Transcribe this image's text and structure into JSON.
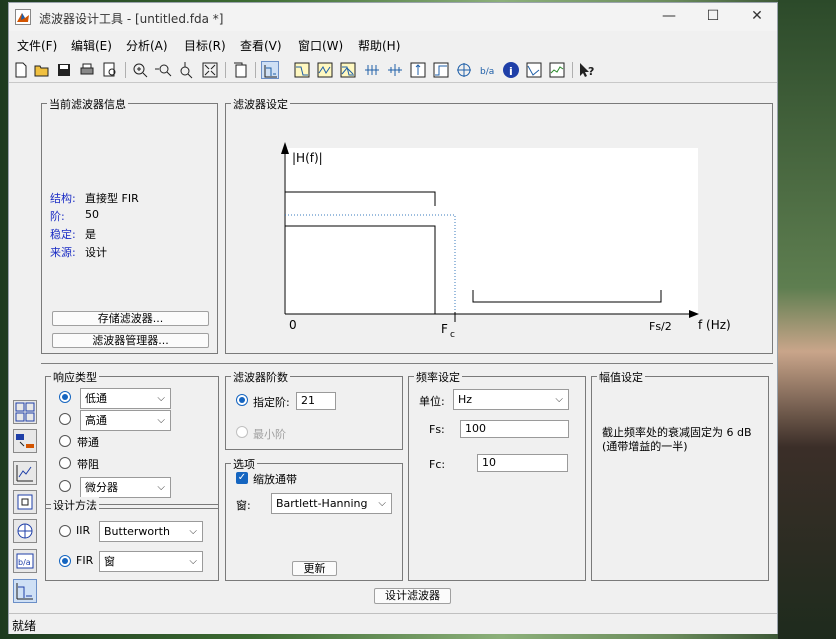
{
  "window": {
    "title": "滤波器设计工具 - [untitled.fda *]",
    "minimize": "—",
    "maximize": "☐",
    "close": "✕"
  },
  "menu": [
    "文件(F)",
    "编辑(E)",
    "分析(A)",
    "目标(R)",
    "查看(V)",
    "窗口(W)",
    "帮助(H)"
  ],
  "info": {
    "title": "当前滤波器信息",
    "rows": [
      {
        "label": "结构:",
        "value": "直接型 FIR"
      },
      {
        "label": "阶:",
        "value": "50"
      },
      {
        "label": "稳定:",
        "value": "是"
      },
      {
        "label": "来源:",
        "value": "设计"
      }
    ],
    "store_button": "存储滤波器...",
    "manager_button": "滤波器管理器..."
  },
  "spec": {
    "title": "滤波器设定",
    "ylabel": "|H(f)|",
    "x0": "0",
    "fc_main": "F",
    "fc_sub": "c",
    "fs2": "Fs/2",
    "xlabel": "f (Hz)"
  },
  "response": {
    "title": "响应类型",
    "options": [
      {
        "label": "低通",
        "selected": true
      },
      {
        "label": "高通",
        "selected": false
      },
      {
        "label": "带通",
        "selected": false
      },
      {
        "label": "带阻",
        "selected": false
      },
      {
        "label": "微分器",
        "selected": false
      }
    ]
  },
  "design": {
    "title": "设计方法",
    "iir_label": "IIR",
    "iir_value": "Butterworth",
    "fir_label": "FIR",
    "fir_value": "窗",
    "selected": "FIR"
  },
  "order": {
    "title": "滤波器阶数",
    "specify_label": "指定阶:",
    "specify_value": "21",
    "min_label": "最小阶"
  },
  "options": {
    "title": "选项",
    "scale_label": "缩放通带",
    "scale_checked": true,
    "window_label": "窗:",
    "window_value": "Bartlett-Hanning",
    "update_button": "更新"
  },
  "freq": {
    "title": "频率设定",
    "unit_label": "单位:",
    "unit_value": "Hz",
    "fs_label": "Fs:",
    "fs_value": "100",
    "fc_label": "Fc:",
    "fc_value": "10"
  },
  "mag": {
    "title": "幅值设定",
    "line1": "截止频率处的衰减固定为 6 dB",
    "line2": "(通带增益的一半)"
  },
  "design_button": "设计滤波器",
  "status": "就绪",
  "colors": {
    "accent": "#1565c0",
    "info_label": "#1a2cc4"
  }
}
